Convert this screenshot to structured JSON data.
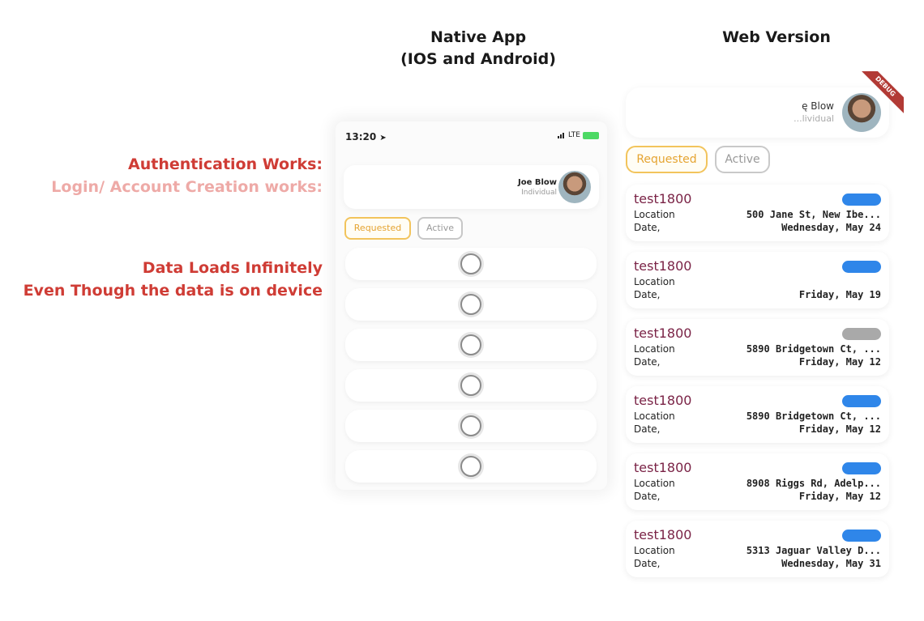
{
  "titles": {
    "native_line1": "Native App",
    "native_line2": "(IOS and Android)",
    "web": "Web Version"
  },
  "notes": {
    "auth": "Authentication Works:",
    "login": "Login/ Account Creation works:",
    "data1": "Data Loads Infinitely",
    "data2": "Even Though the data is on device"
  },
  "colors": {
    "note_red": "#cf3c35",
    "note_pink": "#eeaaa7",
    "requested_accent": "#f2c45c",
    "card_title": "#7a2346",
    "pill_blue": "#2f86e9",
    "pill_grey": "#a9a9a9"
  },
  "native": {
    "status_time": "13:20",
    "status_location_icon": "location-arrow-icon",
    "status_network": "LTE",
    "user_name": "Joe Blow",
    "user_role": "Individual",
    "tabs": [
      "Requested",
      "Active"
    ],
    "loading_rows": 6
  },
  "web": {
    "user_name": "ę Blow",
    "user_role": "...lividual",
    "debug_banner": "DEBUG",
    "tabs": [
      "Requested",
      "Active"
    ],
    "location_label": "Location",
    "date_label": "Date,",
    "cards": [
      {
        "title": "test1800",
        "location": "500 Jane St, New Ibe...",
        "date": "Wednesday, May 24",
        "status": "blue"
      },
      {
        "title": "test1800",
        "location": "",
        "date": "Friday, May 19",
        "status": "blue"
      },
      {
        "title": "test1800",
        "location": "5890 Bridgetown Ct, ...",
        "date": "Friday, May 12",
        "status": "grey"
      },
      {
        "title": "test1800",
        "location": "5890 Bridgetown Ct, ...",
        "date": "Friday, May 12",
        "status": "blue"
      },
      {
        "title": "test1800",
        "location": "8908 Riggs Rd, Adelp...",
        "date": "Friday, May 12",
        "status": "blue"
      },
      {
        "title": "test1800",
        "location": "5313 Jaguar Valley D...",
        "date": "Wednesday, May 31",
        "status": "blue"
      }
    ]
  }
}
